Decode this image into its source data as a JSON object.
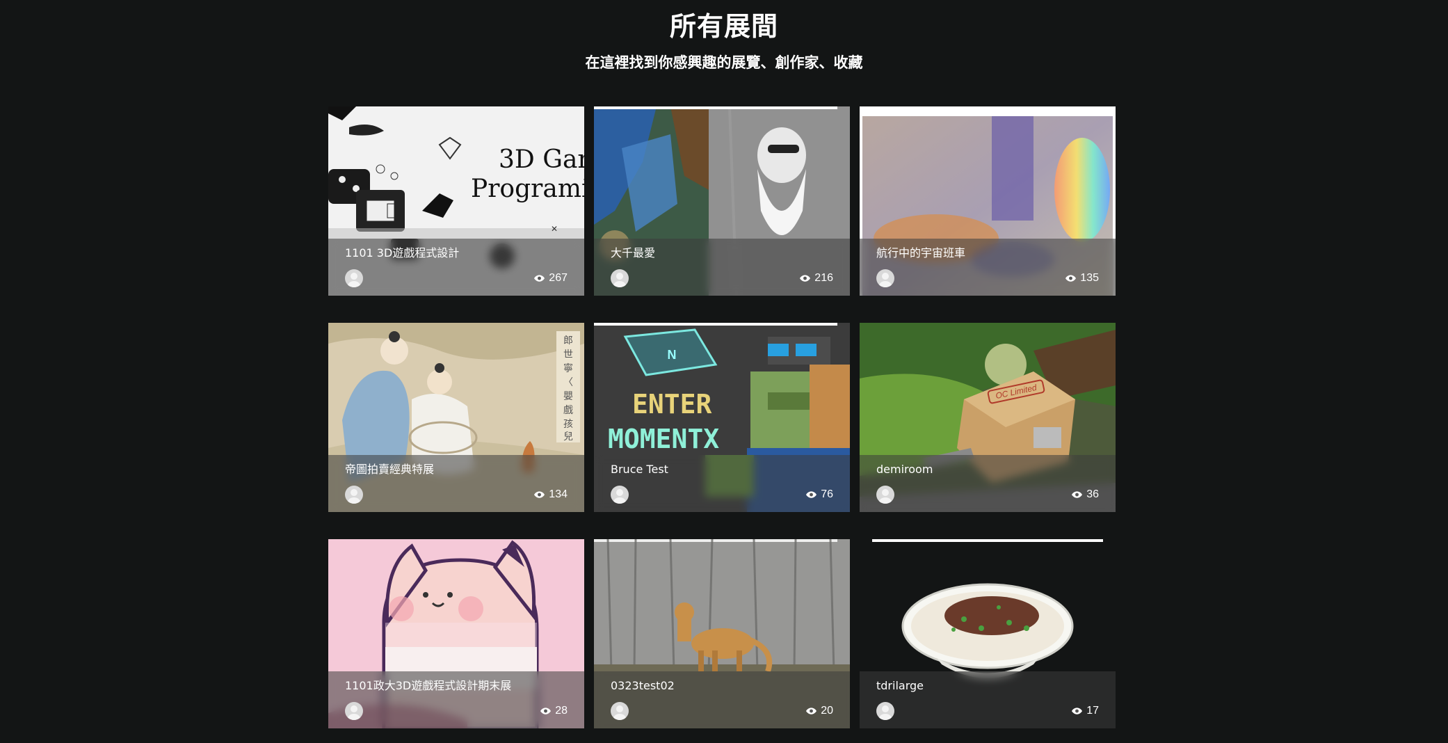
{
  "header": {
    "title": "所有展間",
    "subtitle": "在這裡找到你感興趣的展覽、創作家、收藏"
  },
  "exhibitions": [
    {
      "title": "1101 3D遊戲程式設計",
      "views": "267",
      "thumb_text": "3D Gar\nProgrami"
    },
    {
      "title": "大千最愛",
      "views": "216"
    },
    {
      "title": "航行中的宇宙班車",
      "views": "135"
    },
    {
      "title": "帝圖拍賣經典特展",
      "views": "134",
      "thumb_text": "郎世寧〈嬰戲孩兒圖〉"
    },
    {
      "title": "Bruce Test",
      "views": "76",
      "thumb_text": "ENTER MOMENTX"
    },
    {
      "title": "demiroom",
      "views": "36",
      "thumb_text": "OC Limited"
    },
    {
      "title": "1101政大3D遊戲程式設計期末展",
      "views": "28"
    },
    {
      "title": "0323test02",
      "views": "20"
    },
    {
      "title": "tdrilarge",
      "views": "17"
    }
  ]
}
